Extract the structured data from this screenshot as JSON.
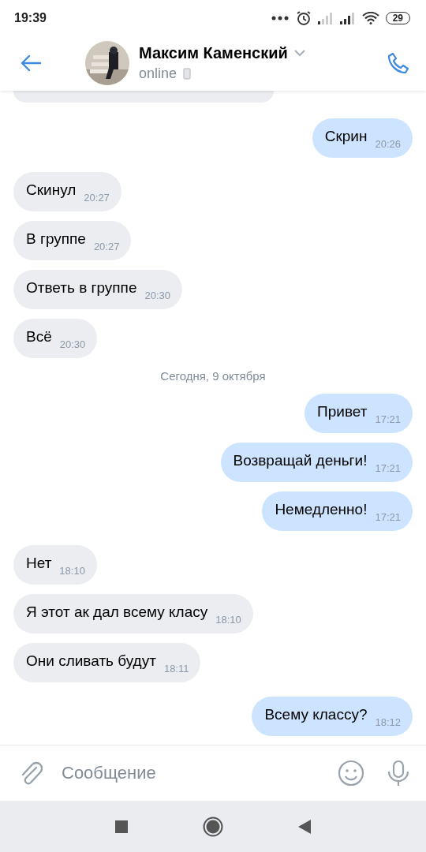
{
  "status_bar": {
    "time": "19:39",
    "battery": "29"
  },
  "header": {
    "name": "Максим Каменский",
    "status": "online"
  },
  "messages": [
    {
      "kind": "message",
      "outgoing": true,
      "text": "Скрин",
      "time": "20:26"
    },
    {
      "kind": "message",
      "outgoing": false,
      "text": "Скинул",
      "time": "20:27"
    },
    {
      "kind": "message",
      "outgoing": false,
      "text": "В группе",
      "time": "20:27"
    },
    {
      "kind": "message",
      "outgoing": false,
      "text": "Ответь в группе",
      "time": "20:30"
    },
    {
      "kind": "message",
      "outgoing": false,
      "text": "Всё",
      "time": "20:30"
    },
    {
      "kind": "date",
      "text": "Сегодня, 9 октября"
    },
    {
      "kind": "message",
      "outgoing": true,
      "text": "Привет",
      "time": "17:21"
    },
    {
      "kind": "message",
      "outgoing": true,
      "text": "Возвращай деньги!",
      "time": "17:21"
    },
    {
      "kind": "message",
      "outgoing": true,
      "text": "Немедленно!",
      "time": "17:21"
    },
    {
      "kind": "message",
      "outgoing": false,
      "text": "Нет",
      "time": "18:10"
    },
    {
      "kind": "message",
      "outgoing": false,
      "text": "Я этот ак дал всему класу",
      "time": "18:10"
    },
    {
      "kind": "message",
      "outgoing": false,
      "text": "Они сливать будут",
      "time": "18:11"
    },
    {
      "kind": "message",
      "outgoing": true,
      "text": "Всему классу?",
      "time": "18:12"
    }
  ],
  "composer": {
    "placeholder": "Сообщение"
  }
}
